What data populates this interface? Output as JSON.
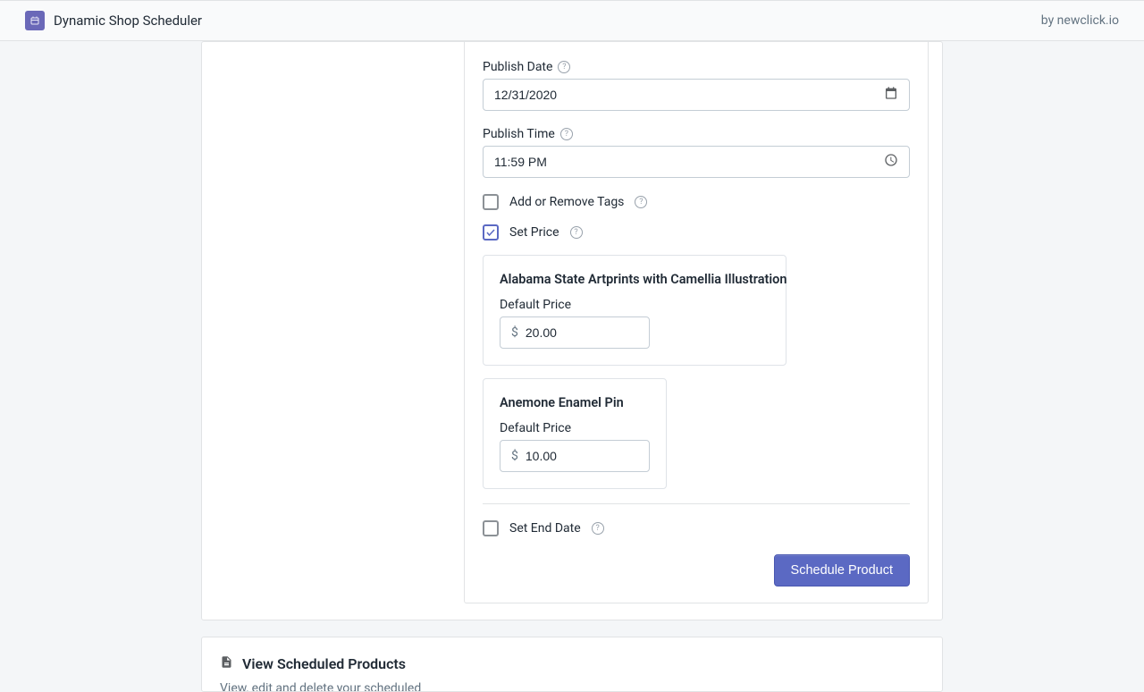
{
  "header": {
    "app_title": "Dynamic Shop Scheduler",
    "by_text": "by newclick.io"
  },
  "form": {
    "publish_date_label": "Publish Date",
    "publish_date_value": "12/31/2020",
    "publish_time_label": "Publish Time",
    "publish_time_value": "11:59 PM",
    "tags_label": "Add or Remove Tags",
    "set_price_label": "Set Price",
    "default_price_label": "Default Price",
    "currency_symbol": "$",
    "set_end_date_label": "Set End Date",
    "schedule_button": "Schedule Product"
  },
  "products": [
    {
      "title": "Alabama State Artprints with Camellia Illustration",
      "price": "20.00"
    },
    {
      "title": "Anemone Enamel Pin",
      "price": "10.00"
    }
  ],
  "bottom": {
    "title": "View Scheduled Products",
    "desc": "View, edit and delete your scheduled"
  }
}
